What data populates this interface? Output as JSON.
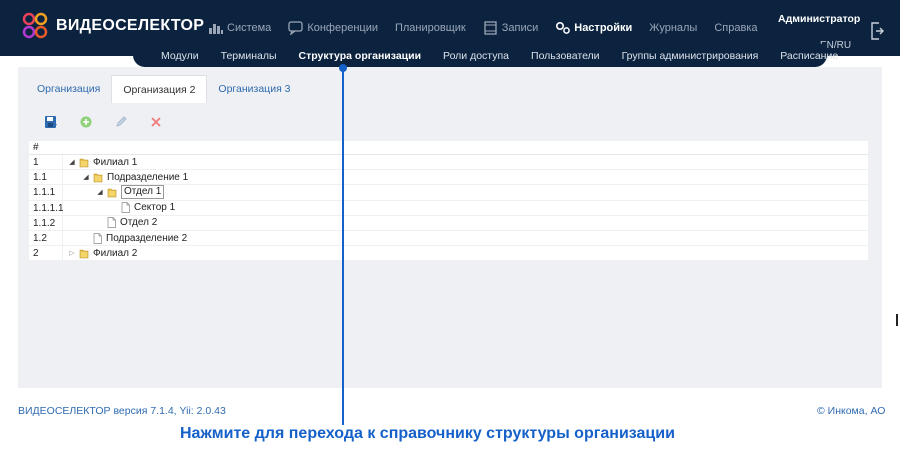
{
  "header": {
    "brand": "ВИДЕОСЕЛЕКТОР",
    "nav": [
      {
        "label": "Система",
        "icon": "bar-chart-icon",
        "active": false
      },
      {
        "label": "Конференции",
        "icon": "chat-icon",
        "active": false
      },
      {
        "label": "Планировщик",
        "icon": "",
        "active": false
      },
      {
        "label": "Записи",
        "icon": "film-icon",
        "active": false
      },
      {
        "label": "Настройки",
        "icon": "gears-icon",
        "active": true
      },
      {
        "label": "Журналы",
        "icon": "",
        "active": false
      },
      {
        "label": "Справка",
        "icon": "",
        "active": false
      }
    ],
    "user": "Администратор",
    "lang": "EN/RU",
    "logout_icon": "logout-icon"
  },
  "subnav": [
    {
      "label": "Модули",
      "active": false
    },
    {
      "label": "Терминалы",
      "active": false
    },
    {
      "label": "Структура организации",
      "active": true
    },
    {
      "label": "Роли доступа",
      "active": false
    },
    {
      "label": "Пользователи",
      "active": false
    },
    {
      "label": "Группы администрирования",
      "active": false
    },
    {
      "label": "Расписание",
      "active": false
    }
  ],
  "tabs": [
    {
      "label": "Организация",
      "active": false
    },
    {
      "label": "Организация 2",
      "active": true
    },
    {
      "label": "Организация 3",
      "active": false
    }
  ],
  "toolbar": {
    "save_icon": "save-icon",
    "add_icon": "add-icon",
    "edit_icon": "edit-icon",
    "delete_icon": "delete-icon"
  },
  "tree": {
    "header": "#",
    "rows": [
      {
        "num": "1",
        "level": 0,
        "expander": "expanded",
        "type": "folder",
        "label": "Филиал 1",
        "selected": false
      },
      {
        "num": "1.1",
        "level": 1,
        "expander": "expanded",
        "type": "folder",
        "label": "Подразделение 1",
        "selected": false
      },
      {
        "num": "1.1.1",
        "level": 2,
        "expander": "expanded",
        "type": "folder",
        "label": "Отдел 1",
        "selected": true
      },
      {
        "num": "1.1.1.1",
        "level": 3,
        "expander": "none",
        "type": "document",
        "label": "Сектор 1",
        "selected": false
      },
      {
        "num": "1.1.2",
        "level": 2,
        "expander": "none",
        "type": "document",
        "label": "Отдел 2",
        "selected": false
      },
      {
        "num": "1.2",
        "level": 1,
        "expander": "none",
        "type": "document",
        "label": "Подразделение 2",
        "selected": false
      },
      {
        "num": "2",
        "level": 0,
        "expander": "collapsed",
        "type": "folder",
        "label": "Филиал 2",
        "selected": false
      }
    ]
  },
  "footer": {
    "version": "ВИДЕОСЕЛЕКТОР версия 7.1.4, Yii: 2.0.43",
    "copyright": "© Инкома, АО"
  },
  "hint": "Нажмите для перехода к справочнику структуры организации",
  "colors": {
    "header_bg": "#0c2340",
    "link": "#2f6bb0",
    "hint": "#1560c9",
    "panel_bg": "#eef0f3"
  }
}
